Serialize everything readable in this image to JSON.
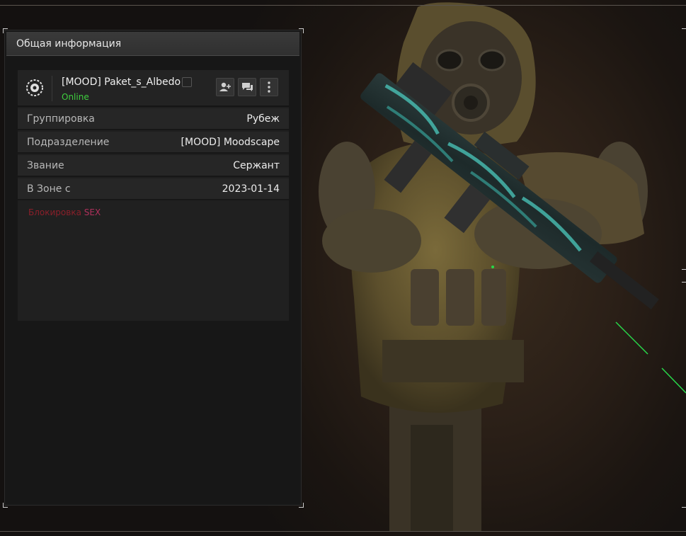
{
  "panel": {
    "title": "Общая информация"
  },
  "player": {
    "name": "[MOOD] Paket_s_Albedo",
    "status": "Online",
    "status_color": "#3ecf3e",
    "emblem_icon": "emblem-icon",
    "copy_icon": "copy-icon",
    "actions": [
      {
        "name": "add-friend-button",
        "icon": "add-user-icon"
      },
      {
        "name": "message-button",
        "icon": "chat-icon"
      },
      {
        "name": "more-button",
        "icon": "more-vertical-icon"
      }
    ]
  },
  "info_rows": [
    {
      "label": "Группировка",
      "value": "Рубеж"
    },
    {
      "label": "Подразделение",
      "value": "[MOOD] Moodscape"
    },
    {
      "label": "Звание",
      "value": "Сержант"
    },
    {
      "label": "В Зоне с",
      "value": "2023-01-14"
    }
  ],
  "note": {
    "label": "Блокировка",
    "value": "SEX",
    "label_color": "#8a1f2a",
    "value_color": "#b0305c"
  }
}
